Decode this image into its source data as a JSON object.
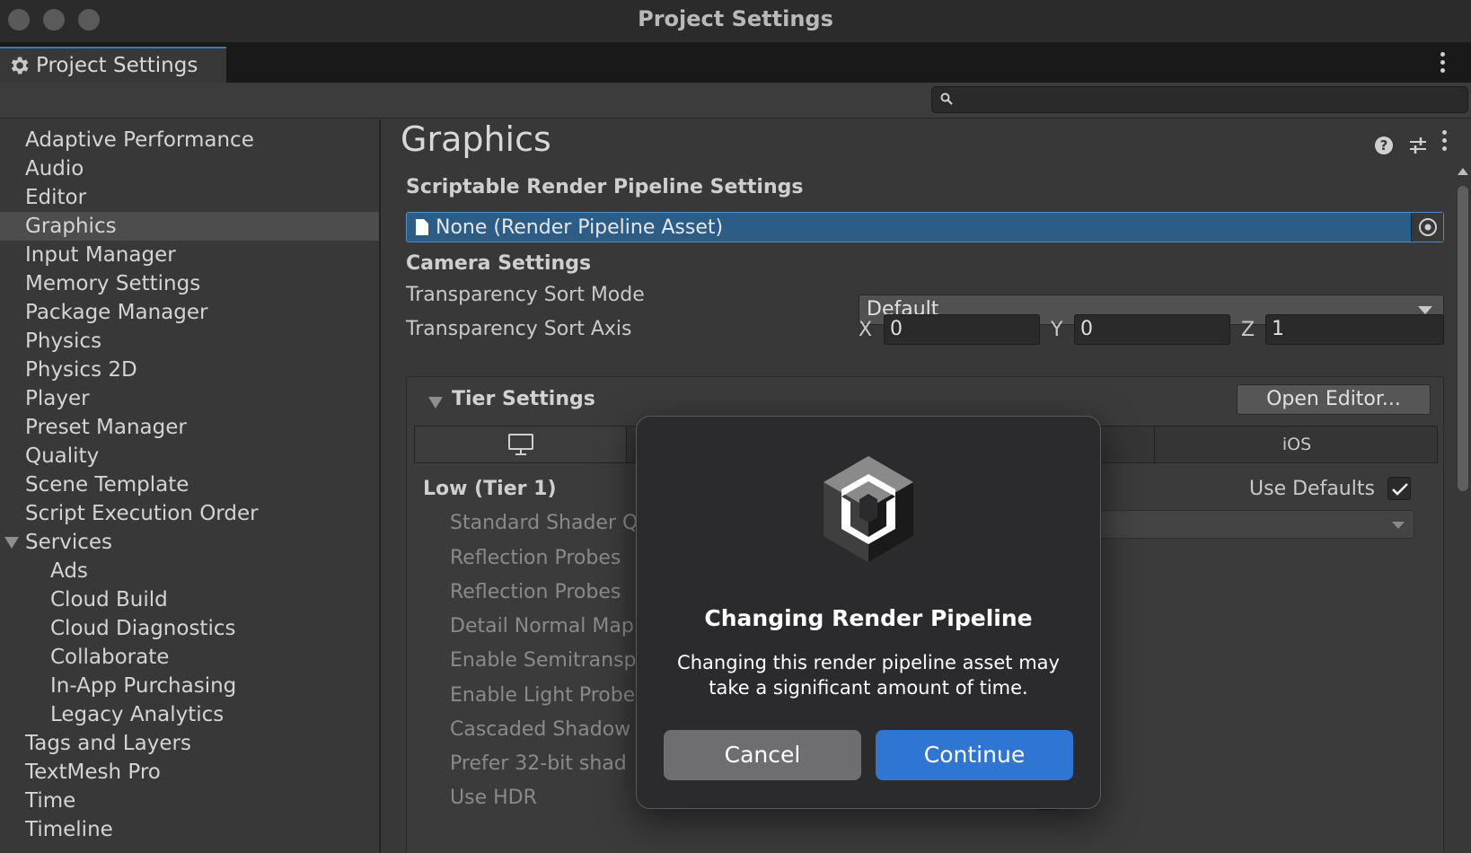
{
  "window": {
    "title": "Project Settings"
  },
  "tab": {
    "label": "Project Settings",
    "icon": "gear-icon"
  },
  "search": {
    "value": "",
    "icon": "search-icon"
  },
  "sidebar": {
    "items": [
      {
        "label": "Adaptive Performance"
      },
      {
        "label": "Audio"
      },
      {
        "label": "Editor"
      },
      {
        "label": "Graphics",
        "selected": true
      },
      {
        "label": "Input Manager"
      },
      {
        "label": "Memory Settings"
      },
      {
        "label": "Package Manager"
      },
      {
        "label": "Physics"
      },
      {
        "label": "Physics 2D"
      },
      {
        "label": "Player"
      },
      {
        "label": "Preset Manager"
      },
      {
        "label": "Quality"
      },
      {
        "label": "Scene Template"
      },
      {
        "label": "Script Execution Order"
      },
      {
        "label": "Services",
        "expanded": true
      },
      {
        "label": "Ads",
        "child": true
      },
      {
        "label": "Cloud Build",
        "child": true
      },
      {
        "label": "Cloud Diagnostics",
        "child": true
      },
      {
        "label": "Collaborate",
        "child": true
      },
      {
        "label": "In-App Purchasing",
        "child": true
      },
      {
        "label": "Legacy Analytics",
        "child": true
      },
      {
        "label": "Tags and Layers"
      },
      {
        "label": "TextMesh Pro"
      },
      {
        "label": "Time"
      },
      {
        "label": "Timeline"
      }
    ]
  },
  "main": {
    "title": "Graphics",
    "srp_section": "Scriptable Render Pipeline Settings",
    "srp_value": "None (Render Pipeline Asset)",
    "camera_section": "Camera Settings",
    "sort_mode_label": "Transparency Sort Mode",
    "sort_mode_value": "Default",
    "sort_axis_label": "Transparency Sort Axis",
    "axis": {
      "x_label": "X",
      "x": "0",
      "y_label": "Y",
      "y": "0",
      "z_label": "Z",
      "z": "1"
    },
    "tier": {
      "title": "Tier Settings",
      "open_editor": "Open Editor...",
      "platform_tab_ios": "iOS",
      "low_tier": "Low (Tier 1)",
      "use_defaults": "Use Defaults",
      "rows": [
        "Standard Shader Q",
        "Reflection Probes",
        "Reflection Probes",
        "Detail Normal Map",
        "Enable Semitransp",
        "Enable Light Probe",
        "Cascaded Shadow",
        "Prefer 32-bit shad",
        "Use HDR"
      ]
    }
  },
  "modal": {
    "title": "Changing Render Pipeline",
    "message": "Changing this render pipeline asset may take a significant amount of time.",
    "cancel": "Cancel",
    "continue": "Continue"
  },
  "colors": {
    "accent": "#2f76d2",
    "selected_field": "#2c5d87",
    "background": "#383838"
  }
}
